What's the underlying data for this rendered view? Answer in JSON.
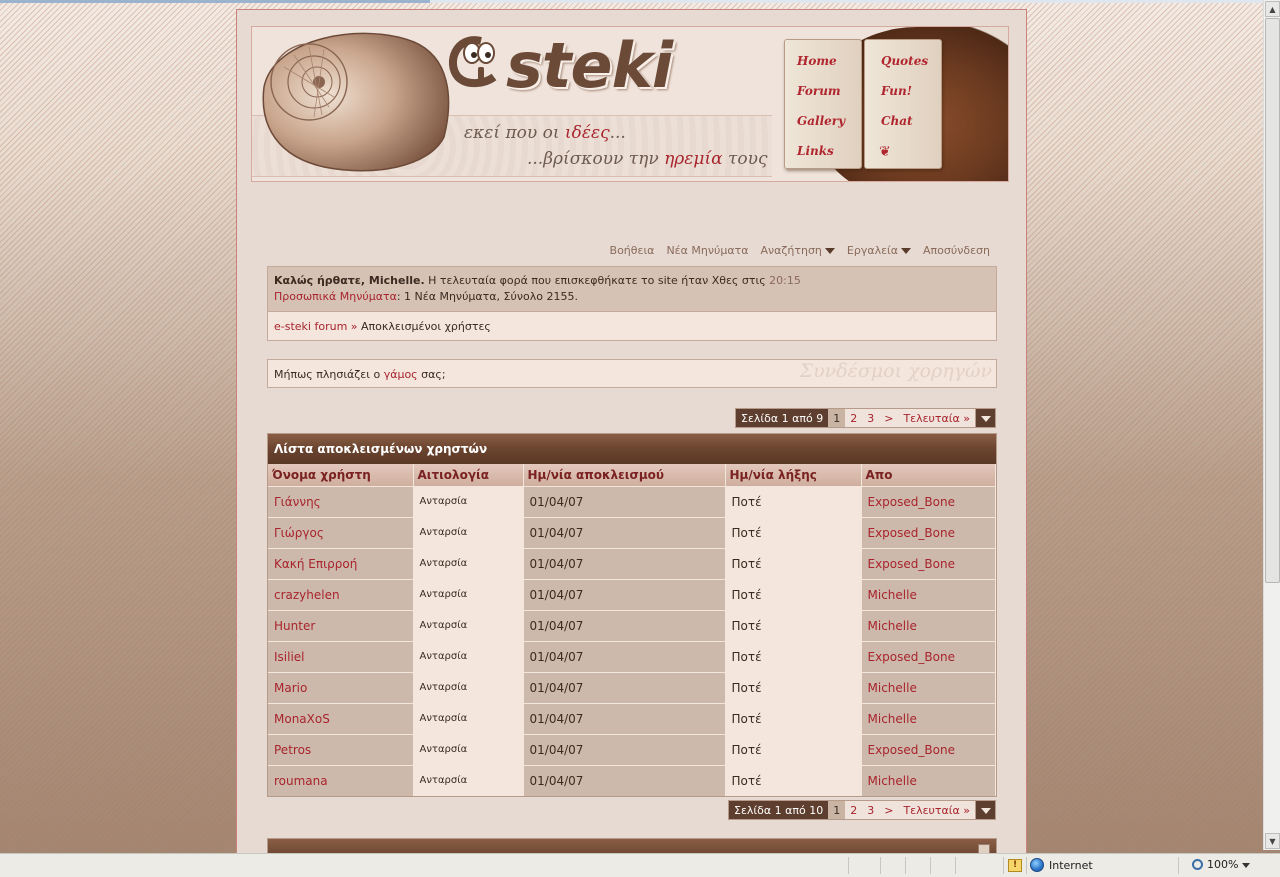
{
  "header": {
    "logo_text": "steki",
    "tagline_part1": "εκεί που οι ",
    "tagline_highlight1": "ιδέες",
    "tagline_part1_end": "...",
    "tagline_part2": "...βρίσκουν την ",
    "tagline_highlight2": "ηρεμία",
    "tagline_part2_end": " τους",
    "book_links_left": [
      "Home",
      "Forum",
      "Gallery",
      "Links"
    ],
    "book_links_right": [
      "Quotes",
      "Fun!",
      "Chat"
    ]
  },
  "navbar": {
    "help": "Βοήθεια",
    "new_posts": "Νέα Μηνύματα",
    "search": "Αναζήτηση",
    "tools": "Εργαλεία",
    "logout": "Αποσύνδεση"
  },
  "welcome": {
    "greeting": "Καλώς ήρθατε, Michelle.",
    "last_visit_text": " Η τελευταία φορά που επισκεφθήκατε το site ήταν Χθες στις ",
    "last_visit_time": "20:15",
    "pm_link": "Προσωπικά Μηνύματα",
    "pm_summary": ": 1 Νέα Μηνύματα, Σύνολο 2155."
  },
  "breadcrumb": {
    "forum": "e-steki forum",
    "separator": " » ",
    "current": "Αποκλεισμένοι χρήστες"
  },
  "ad": {
    "text_before": "Μήπως πλησιάζει ο ",
    "link": "γάμος",
    "text_after": " σας;",
    "sponsor_label": "Συνδέσμοι χορηγών"
  },
  "pager_top": {
    "label": "Σελίδα 1 από 9",
    "pages": [
      "1",
      "2",
      "3"
    ],
    "next": ">",
    "last": "Τελευταία »"
  },
  "pager_bottom": {
    "label": "Σελίδα 1 από 10",
    "pages": [
      "1",
      "2",
      "3"
    ],
    "next": ">",
    "last": "Τελευταία »"
  },
  "banlist": {
    "title": "Λίστα αποκλεισμένων χρηστών",
    "columns": [
      "Όνομα χρήστη",
      "Αιτιολογία",
      "Ημ/νία αποκλεισμού",
      "Ημ/νία λήξης",
      "Απο"
    ],
    "rows": [
      [
        "Γιάννης",
        "Ανταρσία",
        "01/04/07",
        "Ποτέ",
        "Exposed_Bone"
      ],
      [
        "Γιώργος",
        "Ανταρσία",
        "01/04/07",
        "Ποτέ",
        "Exposed_Bone"
      ],
      [
        "Κακή Επιρροή",
        "Ανταρσία",
        "01/04/07",
        "Ποτέ",
        "Exposed_Bone"
      ],
      [
        "crazyhelen",
        "Ανταρσία",
        "01/04/07",
        "Ποτέ",
        "Michelle"
      ],
      [
        "Hunter",
        "Ανταρσία",
        "01/04/07",
        "Ποτέ",
        "Michelle"
      ],
      [
        "Isiliel",
        "Ανταρσία",
        "01/04/07",
        "Ποτέ",
        "Exposed_Bone"
      ],
      [
        "Mario",
        "Ανταρσία",
        "01/04/07",
        "Ποτέ",
        "Michelle"
      ],
      [
        "MonaXoS",
        "Ανταρσία",
        "01/04/07",
        "Ποτέ",
        "Michelle"
      ],
      [
        "Petros",
        "Ανταρσία",
        "01/04/07",
        "Ποτέ",
        "Exposed_Bone"
      ],
      [
        "roumana",
        "Ανταρσία",
        "01/04/07",
        "Ποτέ",
        "Michelle"
      ]
    ]
  },
  "statusbar": {
    "zone": "Internet",
    "zoom": "100%"
  },
  "colors": {
    "link_red": "#a8242d",
    "wood_brown": "#5e3e2e",
    "panel_beige": "#f4e6dc"
  }
}
